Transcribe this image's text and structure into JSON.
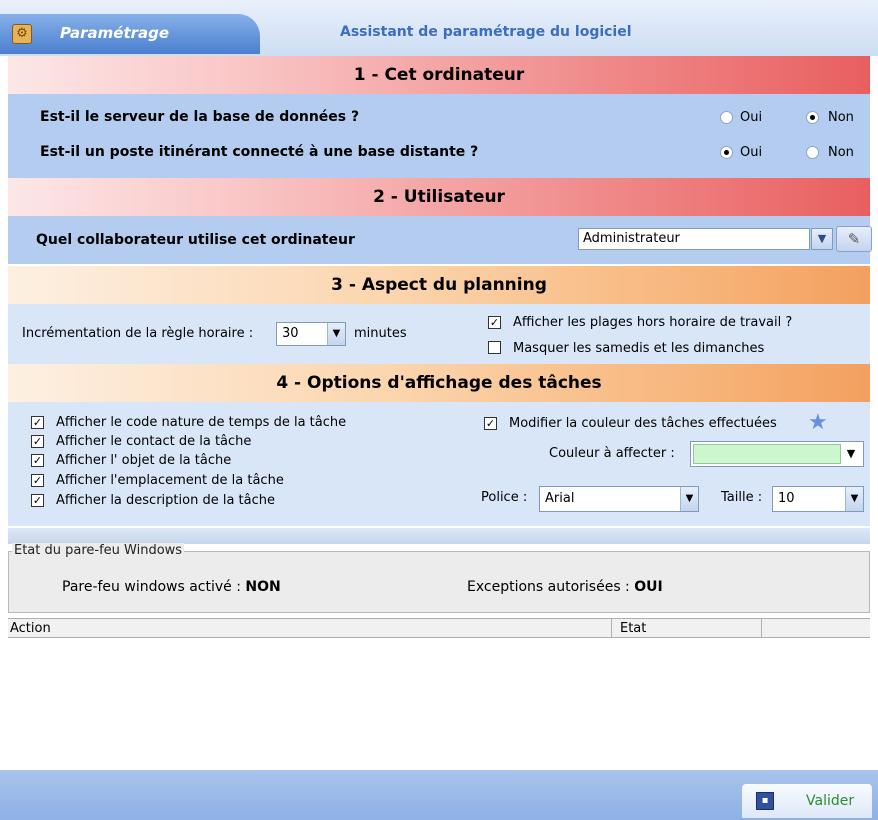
{
  "header": {
    "tab_label": "Paramétrage",
    "title": "Assistant de paramétrage du logiciel"
  },
  "section1": {
    "title": "1 - Cet ordinateur",
    "q1": "Est-il le serveur de la base de données ?",
    "q2": "Est-il un poste itinérant connecté à une base distante ?",
    "yes": "Oui",
    "no": "Non",
    "q1_selected": "Non",
    "q2_selected": "Oui"
  },
  "section2": {
    "title": "2 - Utilisateur",
    "question": "Quel collaborateur utilise cet ordinateur",
    "user_value": "Administrateur"
  },
  "section3": {
    "title": "3 - Aspect du planning",
    "increment_label": "Incrémentation de la règle horaire :",
    "increment_value": "30",
    "increment_unit": "minutes",
    "cb_hors_horaire": "Afficher les plages hors horaire de travail ?",
    "cb_hors_horaire_checked": true,
    "cb_weekends": "Masquer les samedis et les dimanches",
    "cb_weekends_checked": false
  },
  "section4": {
    "title": "4 - Options d'affichage des tâches",
    "options": [
      {
        "label": "Afficher le code nature de temps de la tâche",
        "checked": true
      },
      {
        "label": "Afficher le contact de la tâche",
        "checked": true
      },
      {
        "label": "Afficher l' objet de la tâche",
        "checked": true
      },
      {
        "label": "Afficher l'emplacement de la tâche",
        "checked": true
      },
      {
        "label": "Afficher la description de la tâche",
        "checked": true
      }
    ],
    "modify_color_label": "Modifier la couleur des tâches effectuées",
    "modify_color_checked": true,
    "color_label": "Couleur à affecter :",
    "color_value": "#ccf7cc",
    "police_label": "Police :",
    "police_value": "Arial",
    "taille_label": "Taille :",
    "taille_value": "10"
  },
  "firewall": {
    "legend": "Etat du pare-feu Windows",
    "active_label": "Pare-feu windows activé :",
    "active_value": "NON",
    "exceptions_label": "Exceptions autorisées  :",
    "exceptions_value": "OUI"
  },
  "list": {
    "columns": [
      "Action",
      "Etat",
      ""
    ]
  },
  "footer": {
    "valider_label": "Valider"
  },
  "icons": {
    "tab": "settings-icon",
    "dropdown": "chevron-down-icon",
    "eraser": "eraser-icon",
    "star": "star-icon",
    "save": "floppy-disk-icon"
  }
}
